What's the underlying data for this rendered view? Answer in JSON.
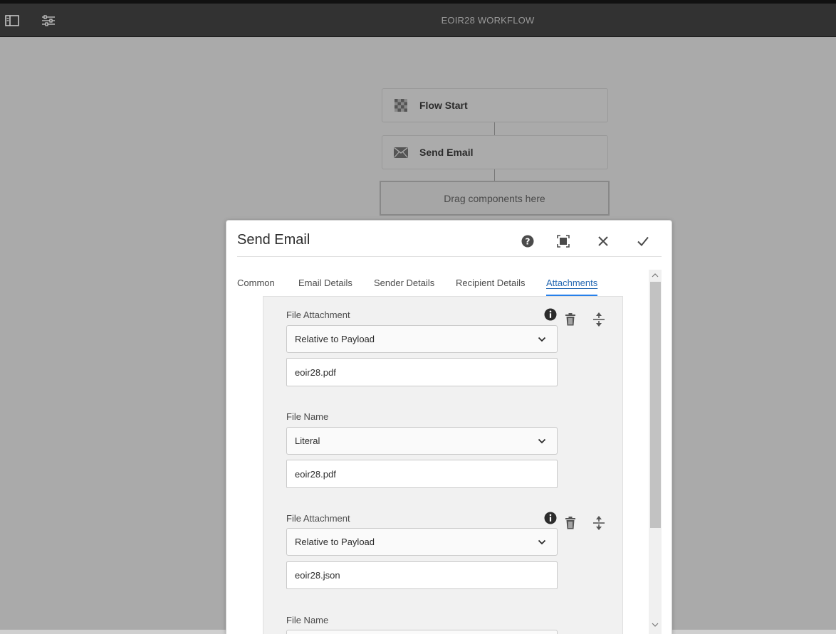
{
  "topbar": {
    "title": "EOIR28 WORKFLOW",
    "icons": [
      "side-panel-icon",
      "page-properties-icon"
    ]
  },
  "canvas": {
    "nodes": [
      {
        "label": "Flow Start",
        "icon": "flow-start-icon"
      },
      {
        "label": "Send Email",
        "icon": "envelope-icon"
      }
    ],
    "dropzone_label": "Drag components here"
  },
  "dialog": {
    "title": "Send Email",
    "actions": [
      "help-icon",
      "fullscreen-icon",
      "close-icon",
      "checkmark-icon"
    ],
    "tabs": [
      {
        "label": "Common",
        "active": false
      },
      {
        "label": "Email Details",
        "active": false
      },
      {
        "label": "Sender Details",
        "active": false
      },
      {
        "label": "Recipient Details",
        "active": false
      },
      {
        "label": "Attachments",
        "active": true
      }
    ],
    "attachments": [
      {
        "file_label": "File Attachment",
        "file_mode": "Relative to Payload",
        "file_value": "eoir28.pdf",
        "name_label": "File Name",
        "name_mode": "Literal",
        "name_value": "eoir28.pdf"
      },
      {
        "file_label": "File Attachment",
        "file_mode": "Relative to Payload",
        "file_value": "eoir28.json",
        "name_label": "File Name"
      }
    ]
  },
  "colors": {
    "topbar_bg": "#323232",
    "canvas_bg": "#aaaaaa",
    "active_tab": "#2468b2",
    "panel_bg": "#f1f1f1"
  }
}
